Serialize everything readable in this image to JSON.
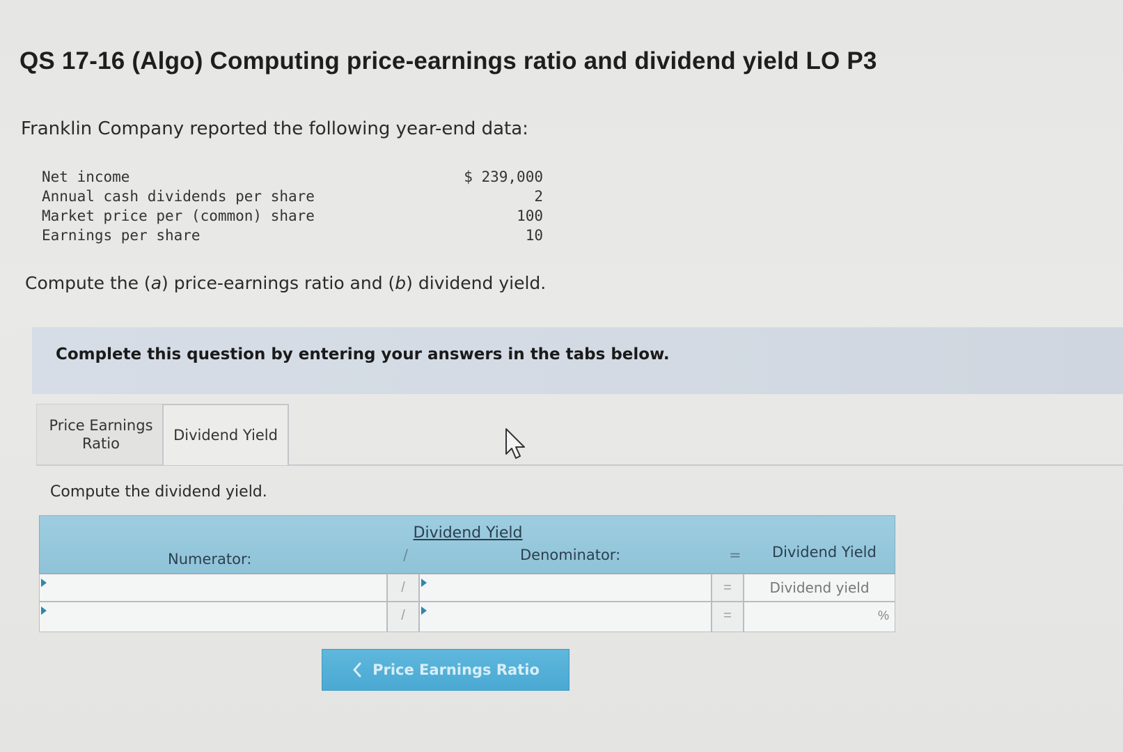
{
  "header": {
    "title": "QS 17-16 (Algo) Computing price-earnings ratio and dividend yield LO P3"
  },
  "problem": {
    "intro": "Franklin Company reported the following year-end data:",
    "rows": [
      {
        "label": "Net income",
        "value": "$ 239,000"
      },
      {
        "label": "Annual cash dividends per share",
        "value": "2"
      },
      {
        "label": "Market price per (common) share",
        "value": "100"
      },
      {
        "label": "Earnings per share",
        "value": "10"
      }
    ],
    "instruction_pre": "Compute the (",
    "instruction_a": "a",
    "instruction_mid": ") price-earnings ratio and (",
    "instruction_b": "b",
    "instruction_post": ") dividend yield."
  },
  "banner": {
    "text": "Complete this question by entering your answers in the tabs below."
  },
  "tabs": [
    {
      "label": "Price Earnings Ratio",
      "active": false
    },
    {
      "label": "Dividend Yield",
      "active": true
    }
  ],
  "panel": {
    "compute_text": "Compute the dividend yield.",
    "table_title": "Dividend Yield",
    "numerator_header": "Numerator:",
    "divide_symbol": "/",
    "denominator_header": "Denominator:",
    "equals_symbol": "=",
    "result_header": "Dividend Yield",
    "row1_result_label": "Dividend yield",
    "row2_result_unit": "%",
    "row1": {
      "numerator": "",
      "denominator": ""
    },
    "row2": {
      "numerator": "",
      "denominator": "",
      "result": ""
    }
  },
  "nav": {
    "prev_label": "Price Earnings Ratio",
    "prev_icon": "chevron-left-icon"
  },
  "colors": {
    "table_header": "#8fc3d8",
    "nav_button": "#4aa9d3",
    "banner": "#d3dae3"
  }
}
